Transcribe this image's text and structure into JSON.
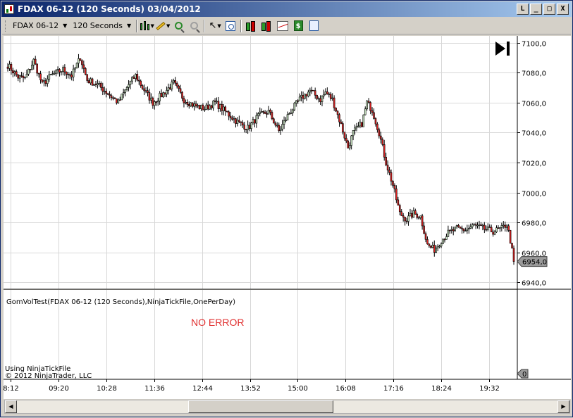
{
  "window": {
    "title": "FDAX 06-12 (120 Seconds)  03/04/2012",
    "buttons": {
      "minimize": "_",
      "restore": "□",
      "close": "X",
      "help": "L"
    }
  },
  "toolbar": {
    "instrument": "FDAX 06-12",
    "interval": "120 Seconds"
  },
  "chart_data": {
    "type": "candlestick",
    "ylim": [
      6936,
      7104
    ],
    "price_ticks": [
      "7100,0",
      "7080,0",
      "7060,0",
      "7040,0",
      "7020,0",
      "7000,0",
      "6980,0",
      "6960,0",
      "6940,0"
    ],
    "price_tick_values": [
      7100,
      7080,
      7060,
      7040,
      7020,
      7000,
      6980,
      6960,
      6940
    ],
    "time_ticks": [
      "8:12",
      "09:20",
      "10:28",
      "11:36",
      "12:44",
      "13:52",
      "15:00",
      "16:08",
      "17:16",
      "18:24",
      "19:32"
    ],
    "last_price": "6954,0",
    "last_price_value": 6954,
    "up_color": "#c8e4c0",
    "down_color": "#e02020",
    "anchors": [
      [
        0,
        7085
      ],
      [
        6,
        7077
      ],
      [
        10,
        7076
      ],
      [
        15,
        7088
      ],
      [
        20,
        7072
      ],
      [
        25,
        7078
      ],
      [
        32,
        7082
      ],
      [
        37,
        7078
      ],
      [
        42,
        7090
      ],
      [
        46,
        7075
      ],
      [
        52,
        7072
      ],
      [
        58,
        7066
      ],
      [
        64,
        7060
      ],
      [
        70,
        7072
      ],
      [
        74,
        7078
      ],
      [
        78,
        7070
      ],
      [
        84,
        7060
      ],
      [
        90,
        7066
      ],
      [
        96,
        7073
      ],
      [
        102,
        7062
      ],
      [
        108,
        7058
      ],
      [
        114,
        7056
      ],
      [
        120,
        7060
      ],
      [
        127,
        7053
      ],
      [
        133,
        7047
      ],
      [
        139,
        7043
      ],
      [
        145,
        7051
      ],
      [
        151,
        7054
      ],
      [
        157,
        7041
      ],
      [
        163,
        7053
      ],
      [
        169,
        7062
      ],
      [
        175,
        7068
      ],
      [
        181,
        7062
      ],
      [
        184,
        7067
      ],
      [
        188,
        7062
      ],
      [
        193,
        7045
      ],
      [
        197,
        7030
      ],
      [
        200,
        7040
      ],
      [
        205,
        7046
      ],
      [
        208,
        7060
      ],
      [
        211,
        7055
      ],
      [
        215,
        7040
      ],
      [
        219,
        7020
      ],
      [
        223,
        7005
      ],
      [
        227,
        6986
      ],
      [
        231,
        6982
      ],
      [
        235,
        6986
      ],
      [
        239,
        6984
      ],
      [
        243,
        6965
      ],
      [
        247,
        6962
      ],
      [
        251,
        6968
      ],
      [
        255,
        6973
      ],
      [
        260,
        6976
      ],
      [
        265,
        6975
      ],
      [
        270,
        6978
      ],
      [
        275,
        6976
      ],
      [
        281,
        6974
      ],
      [
        286,
        6976
      ],
      [
        289,
        6979
      ],
      [
        291,
        6968
      ],
      [
        293,
        6954
      ]
    ]
  },
  "indicator": {
    "name": "GomVolTest(FDAX 06-12 (120 Seconds),NinjaTickFile,OnePerDay)",
    "message": "NO ERROR",
    "message_color": "#e03030",
    "value_label": "0",
    "footer_line1": "Using NinjaTickFile",
    "footer_line2": "© 2012 NinjaTrader, LLC"
  }
}
